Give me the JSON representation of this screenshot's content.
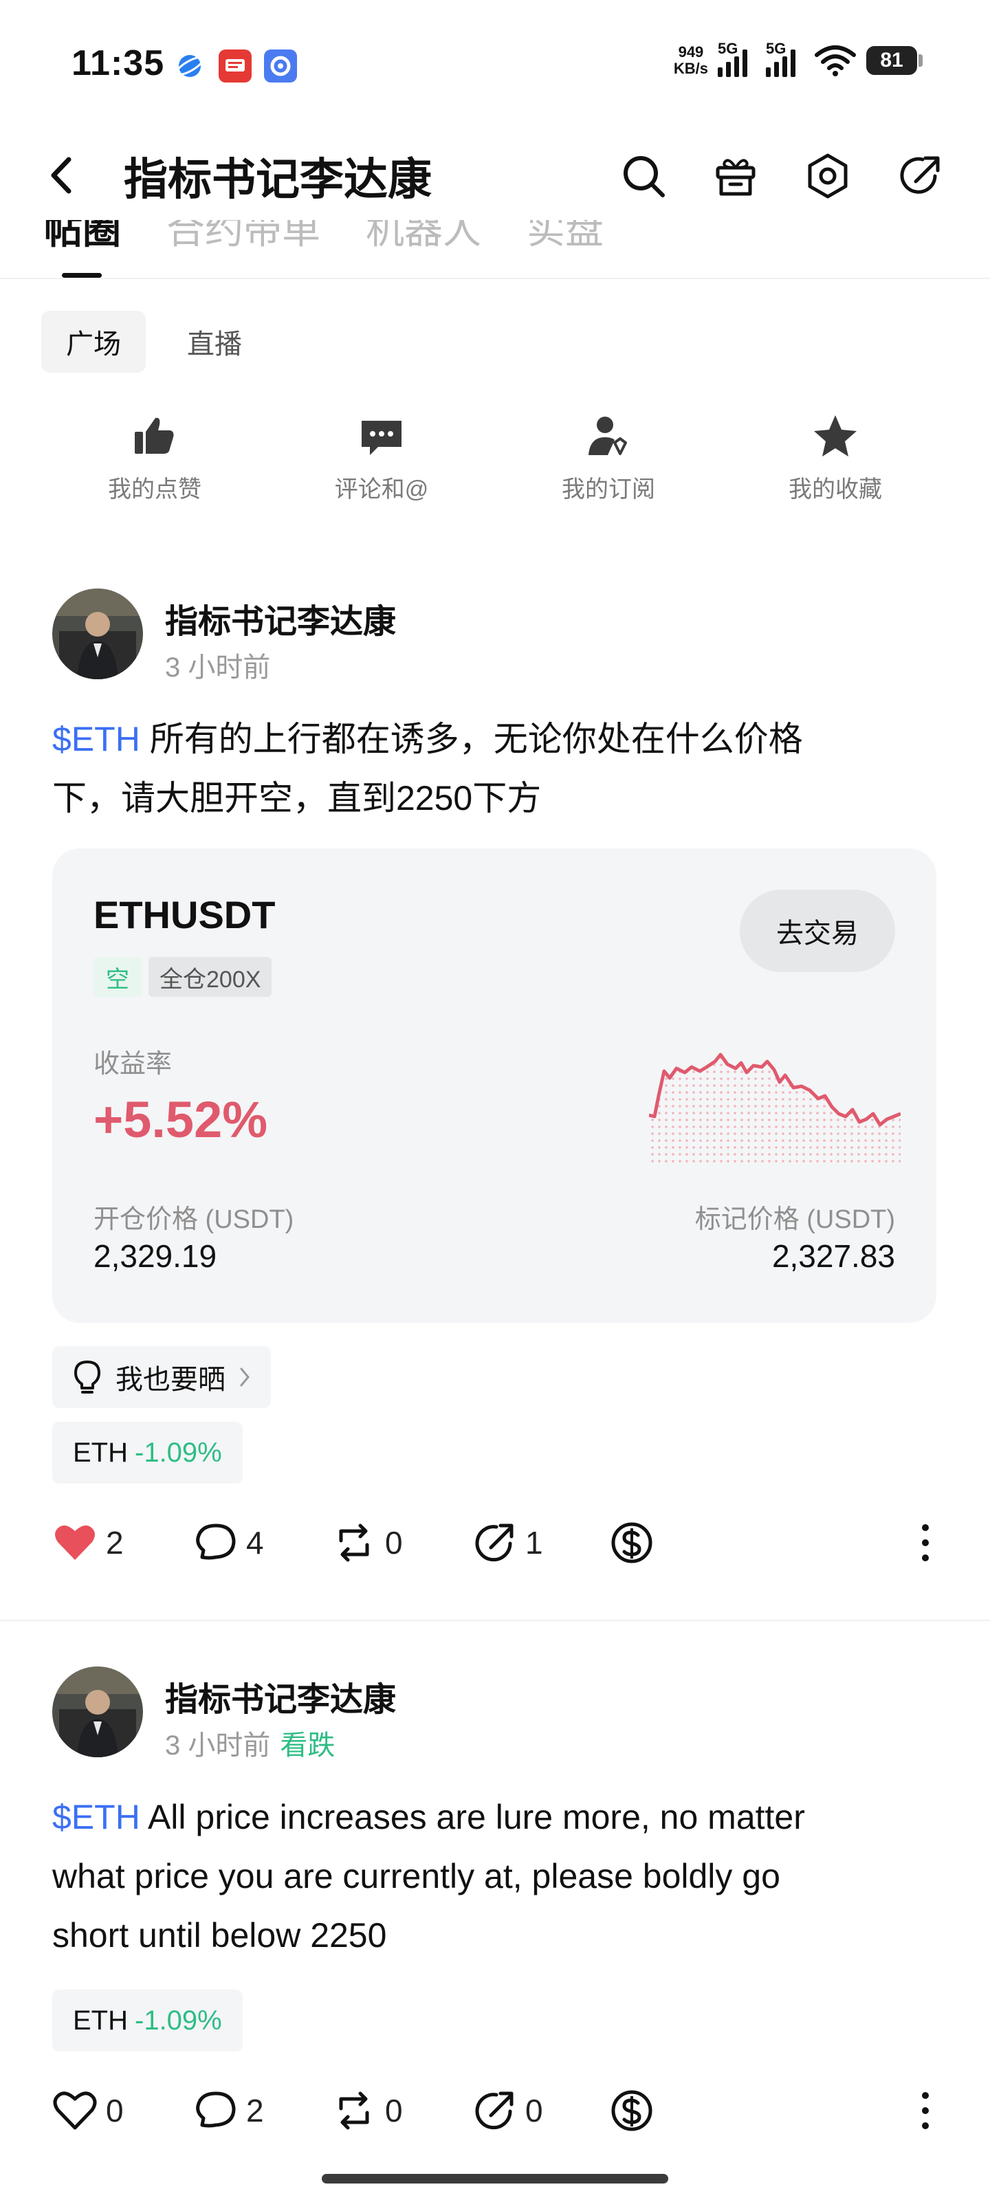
{
  "status_bar": {
    "time": "11:35",
    "net_speed_value": "949",
    "net_speed_unit": "KB/s",
    "signal1_label": "5G",
    "signal2_label": "5G",
    "battery": "81"
  },
  "header": {
    "title": "指标书记李达康",
    "icons": [
      "back-icon",
      "search-icon",
      "gift-icon",
      "settings-icon",
      "share-icon"
    ]
  },
  "tabs": [
    "帖圈",
    "合约带单",
    "机器人",
    "实盘"
  ],
  "subtabs": [
    "广场",
    "直播"
  ],
  "quick_actions": [
    {
      "label": "我的点赞",
      "icon": "thumbs-up-icon"
    },
    {
      "label": "评论和@",
      "icon": "comment-icon"
    },
    {
      "label": "我的订阅",
      "icon": "subscribe-icon"
    },
    {
      "label": "我的收藏",
      "icon": "star-icon"
    }
  ],
  "posts": [
    {
      "author": "指标书记李达康",
      "time": "3 小时前",
      "ticker": "$ETH",
      "line1": " 所有的上行都在诱多，无论你处在什么价格",
      "line2": "下，请大胆开空，直到2250下方",
      "card": {
        "pair": "ETHUSDT",
        "side": "空",
        "leverage": "全仓200X",
        "trade_button": "去交易",
        "roi_label": "收益率",
        "roi": "+5.52%",
        "open_label": "开仓价格 (USDT)",
        "open_price": "2,329.19",
        "mark_label": "标记价格 (USDT)",
        "mark_price": "2,327.83",
        "spark_color": "#e05a6d"
      },
      "share_label": "我也要晒",
      "chip_symbol": "ETH",
      "chip_change": "-1.09%",
      "likes": "2",
      "comments": "4",
      "reposts": "0",
      "shares": "1",
      "liked": true
    },
    {
      "author": "指标书记李达康",
      "time": "3 小时前",
      "sentiment": "看跌",
      "ticker": "$ETH",
      "line1": " All price increases are lure more, no matter",
      "line2": "what price you are currently at, please boldly go",
      "line3": "short until below 2250",
      "chip_symbol": "ETH",
      "chip_change": "-1.09%",
      "likes": "0",
      "comments": "2",
      "reposts": "0",
      "shares": "0",
      "liked": false
    }
  ],
  "colors": {
    "accent_blue": "#3b6ff5",
    "green": "#2ebd85",
    "red": "#e05a6d",
    "like_red": "#e8505b"
  }
}
